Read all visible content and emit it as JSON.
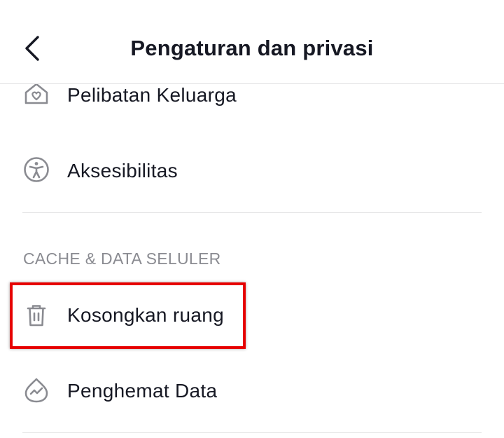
{
  "header": {
    "title": "Pengaturan dan privasi",
    "back_icon": "chevron-left-icon"
  },
  "rows": [
    {
      "label": "Pelibatan Keluarga",
      "icon": "family-home-icon"
    },
    {
      "label": "Aksesibilitas",
      "icon": "accessibility-icon"
    }
  ],
  "section": {
    "title": "CACHE & DATA SELULER",
    "items": [
      {
        "label": "Kosongkan ruang",
        "icon": "trash-icon"
      },
      {
        "label": "Penghemat Data",
        "icon": "data-saver-icon"
      }
    ]
  },
  "colors": {
    "text": "#161823",
    "secondary_text": "#8a8b91",
    "divider": "#e3e3e4",
    "highlight": "#e60000"
  }
}
